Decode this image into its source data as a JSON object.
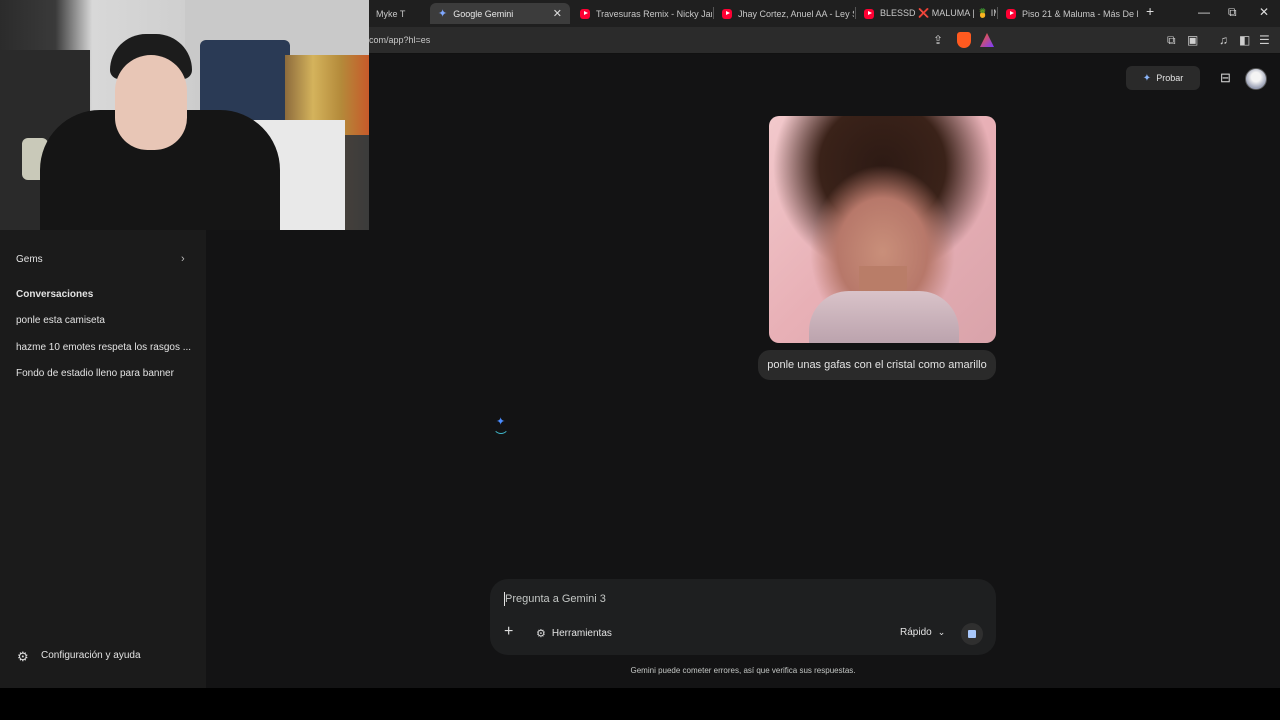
{
  "browser": {
    "tabs": [
      {
        "label": "Myke T"
      },
      {
        "label": "Google Gemini",
        "active": true
      },
      {
        "label": "Travesuras Remix - Nicky Jam F"
      },
      {
        "label": "Jhay Cortez, Anuel AA - Ley Se"
      },
      {
        "label": "BLESSD ❌ MALUMA | 🍍 IMP"
      },
      {
        "label": "Piso 21 & Maluma - Más De La"
      }
    ],
    "new_tab": "+",
    "url": "com/app?hl=es",
    "window_controls": {
      "minimize": "—",
      "restore": "⧉",
      "close": "✕"
    }
  },
  "sidebar": {
    "gems_label": "Gems",
    "conversations_header": "Conversaciones",
    "conversations": [
      "ponle esta camiseta",
      "hazme 10 emotes respeta los rasgos ...",
      "Fondo de estadio lleno para banner"
    ],
    "settings_label": "Configuración y ayuda"
  },
  "header": {
    "try_button": "Probar"
  },
  "chat": {
    "user_message": "ponle unas gafas con el cristal como amarillo"
  },
  "composer": {
    "placeholder": "Pregunta a Gemini 3",
    "tools_label": "Herramientas",
    "mode_label": "Rápido"
  },
  "disclaimer": "Gemini puede cometer errores, así que verifica sus respuestas.",
  "colors": {
    "main_bg": "#131314",
    "sidebar_bg": "#1b1b1b",
    "accent": "#a8c7fa",
    "youtube_red": "#ff0033"
  },
  "icons": {
    "gemini": "sparkle",
    "add": "plus-icon",
    "tools": "sliders-icon",
    "settings": "gear-icon",
    "stop": "stop-icon"
  }
}
